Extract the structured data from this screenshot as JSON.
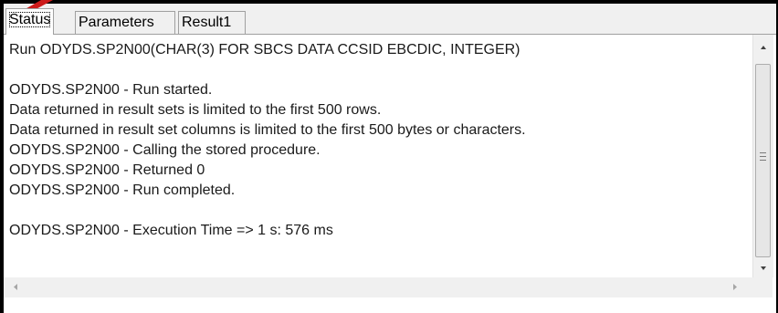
{
  "tabs": {
    "status": "Status",
    "parameters": "Parameters",
    "result1": "Result1"
  },
  "output": {
    "lines": [
      "Run ODYDS.SP2N00(CHAR(3) FOR SBCS DATA CCSID EBCDIC, INTEGER)",
      "",
      "ODYDS.SP2N00 - Run started.",
      "Data returned in result sets is limited to the first 500 rows.",
      "Data returned in result set columns is limited to the first 500 bytes or characters.",
      "ODYDS.SP2N00 - Calling the stored procedure.",
      "ODYDS.SP2N00 - Returned 0",
      "ODYDS.SP2N00 - Run completed.",
      "",
      "ODYDS.SP2N00 - Execution Time => 1 s: 576 ms"
    ]
  },
  "colors": {
    "annotation_arrow": "#cc1a1a",
    "window_border": "#000000",
    "tab_bar_background": "#f0f0f0"
  },
  "icons": {
    "scroll_up": "triangle-up-icon",
    "scroll_down": "triangle-down-icon",
    "scroll_left": "triangle-left-icon",
    "scroll_right": "triangle-right-icon"
  }
}
